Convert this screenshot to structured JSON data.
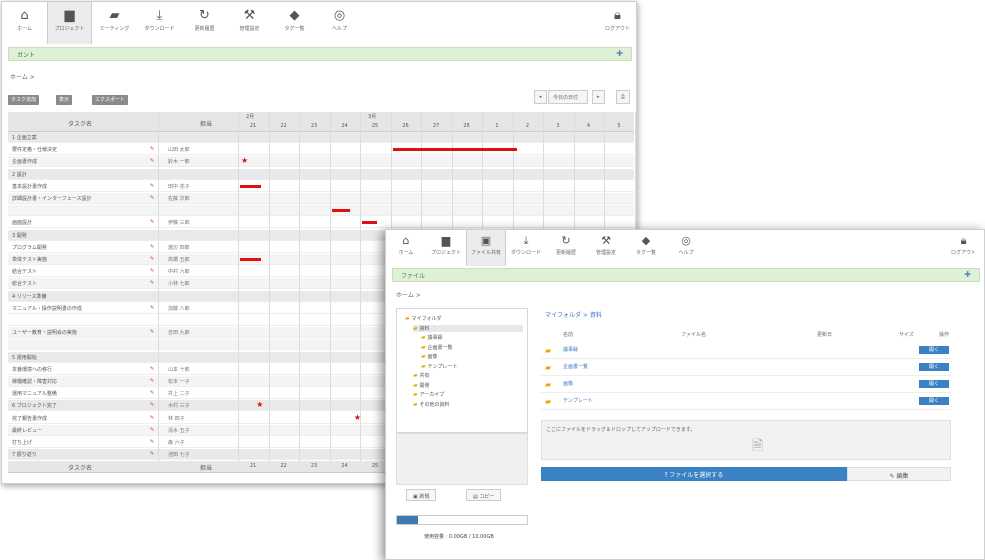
{
  "win1": {
    "toolbar": [
      {
        "icon": "home-icon",
        "glyph": "⌂",
        "label": "ホーム"
      },
      {
        "icon": "folder-icon",
        "glyph": "▆",
        "label": "プロジェクト"
      },
      {
        "icon": "meeting-icon",
        "glyph": "▰",
        "label": "ミーティング"
      },
      {
        "icon": "download-icon",
        "glyph": "⤓",
        "label": "ダウンロード"
      },
      {
        "icon": "refresh-icon",
        "glyph": "↻",
        "label": "更新履歴"
      },
      {
        "icon": "wrench-icon",
        "glyph": "⚒",
        "label": "管理設定"
      },
      {
        "icon": "tag-icon",
        "glyph": "◆",
        "label": "タグ一覧"
      },
      {
        "icon": "help-icon",
        "glyph": "◎",
        "label": "ヘルプ"
      }
    ],
    "logout_label": "ログアウト",
    "banner_text": "ガント",
    "breadcrumb": "ホーム >",
    "buttons": [
      "タスク追加",
      "表示",
      "エクスポート"
    ],
    "nav_label": "今日の日付",
    "table_header": {
      "task": "タスク名",
      "person": "担当",
      "month1": "2月",
      "month2": "3月"
    },
    "days": [
      "21",
      "22",
      "23",
      "24",
      "25",
      "26",
      "27",
      "28",
      "1",
      "2",
      "3",
      "4",
      "5",
      "6",
      "7"
    ],
    "footer_days": [
      "21",
      "22",
      "23",
      "24",
      "25"
    ],
    "rows": [
      {
        "name": "1 企画立案",
        "num": "",
        "person": "",
        "type": "sec"
      },
      {
        "name": "要件定義・仕様決定",
        "num": "",
        "person": "山田 太郎",
        "type": "row"
      },
      {
        "name": "企画書作成",
        "num": "",
        "person": "鈴木 一郎",
        "type": "alt"
      },
      {
        "name": "2 設計",
        "num": "",
        "person": "",
        "type": "sec"
      },
      {
        "name": "基本設計書作成",
        "num": "",
        "person": "田中 花子",
        "type": "row"
      },
      {
        "name": "詳細設計書・インターフェース設計",
        "num": "",
        "person": "佐藤 次郎",
        "type": "alt"
      },
      {
        "name": "",
        "num": "",
        "person": "",
        "type": "alt"
      },
      {
        "name": "画面設計",
        "num": "",
        "person": "伊藤 三郎",
        "type": "row"
      },
      {
        "name": "3 開発",
        "num": "",
        "person": "",
        "type": "sec"
      },
      {
        "name": "プログラム開発",
        "num": "",
        "person": "渡辺 四郎",
        "type": "row"
      },
      {
        "name": "単体テスト実施",
        "num": "",
        "person": "高橋 五郎",
        "type": "alt"
      },
      {
        "name": "結合テスト",
        "num": "",
        "person": "中村 六郎",
        "type": "row"
      },
      {
        "name": "総合テスト",
        "num": "",
        "person": "小林 七郎",
        "type": "alt"
      },
      {
        "name": "4 リリース準備",
        "num": "",
        "person": "",
        "type": "sec"
      },
      {
        "name": "マニュアル・操作説明書の作成",
        "num": "",
        "person": "加藤 八郎",
        "type": "row"
      },
      {
        "name": "",
        "num": "",
        "person": "",
        "type": "row"
      },
      {
        "name": "ユーザー教育・説明会の実施",
        "num": "",
        "person": "吉田 九郎",
        "type": "alt"
      },
      {
        "name": "",
        "num": "",
        "person": "",
        "type": "alt"
      },
      {
        "name": "5 運用開始",
        "num": "",
        "person": "",
        "type": "sec"
      },
      {
        "name": "本番環境への移行",
        "num": "",
        "person": "山本 十郎",
        "type": "row"
      },
      {
        "name": "稼働確認・障害対応",
        "num": "",
        "person": "松本 一子",
        "type": "alt"
      },
      {
        "name": "運用マニュアル整備",
        "num": "",
        "person": "井上 二子",
        "type": "row"
      },
      {
        "name": "6 プロジェクト完了",
        "num": "",
        "person": "木村 三子",
        "type": "sec"
      },
      {
        "name": "完了報告書作成",
        "num": "",
        "person": "林 四子",
        "type": "row"
      },
      {
        "name": "最終レビュー",
        "num": "",
        "person": "清水 五子",
        "type": "alt"
      },
      {
        "name": "打ち上げ",
        "num": "",
        "person": "森 六子",
        "type": "row"
      },
      {
        "name": "7 振り返り",
        "num": "",
        "person": "池田 七子",
        "type": "sec"
      }
    ],
    "footer": {
      "task": "タスク名",
      "person": "担当"
    }
  },
  "win2": {
    "toolbar": [
      {
        "icon": "home-icon",
        "glyph": "⌂",
        "label": "ホーム"
      },
      {
        "icon": "project-icon",
        "glyph": "▆",
        "label": "プロジェクト"
      },
      {
        "icon": "file-share-icon",
        "glyph": "▣",
        "label": "ファイル共有"
      },
      {
        "icon": "download-icon",
        "glyph": "⤓",
        "label": "ダウンロード"
      },
      {
        "icon": "refresh-icon",
        "glyph": "↻",
        "label": "更新履歴"
      },
      {
        "icon": "wrench-icon",
        "glyph": "⚒",
        "label": "管理設定"
      },
      {
        "icon": "tag-icon",
        "glyph": "◆",
        "label": "タグ一覧"
      },
      {
        "icon": "help-icon",
        "glyph": "◎",
        "label": "ヘルプ"
      }
    ],
    "logout_label": "ログアウト",
    "banner_text": "ファイル",
    "breadcrumb": "ホーム >",
    "tree": [
      {
        "label": "マイフォルダ",
        "level": 0
      },
      {
        "label": "資料",
        "level": 1
      },
      {
        "label": "議事録",
        "level": 2
      },
      {
        "label": "企画書一覧",
        "level": 2
      },
      {
        "label": "画像",
        "level": 2
      },
      {
        "label": "テンプレート",
        "level": 2
      },
      {
        "label": "共有",
        "level": 1
      },
      {
        "label": "開発",
        "level": 1
      },
      {
        "label": "アーカイブ",
        "level": 1
      },
      {
        "label": "その他の資料",
        "level": 1
      }
    ],
    "new_folder": "新規",
    "copy": "コピー",
    "quota_fraction": 0.16,
    "quota_text": "使用容量 : 0.00GB / 10.00GB",
    "path": "マイフォルダ > 資料",
    "headers": {
      "name": "名前",
      "filename": "ファイル名",
      "date": "更新日",
      "size": "サイズ",
      "action": "操作"
    },
    "files": [
      {
        "name": "議事録",
        "action": "開く"
      },
      {
        "name": "企画書一覧",
        "action": "開く"
      },
      {
        "name": "画像",
        "action": "開く"
      },
      {
        "name": "テンプレート",
        "action": "開く"
      }
    ],
    "drop_text": "ここにファイルをドラッグ＆ドロップしてアップロードできます。",
    "upload_label": "ファイルを選択する",
    "edit_label": "編集"
  }
}
